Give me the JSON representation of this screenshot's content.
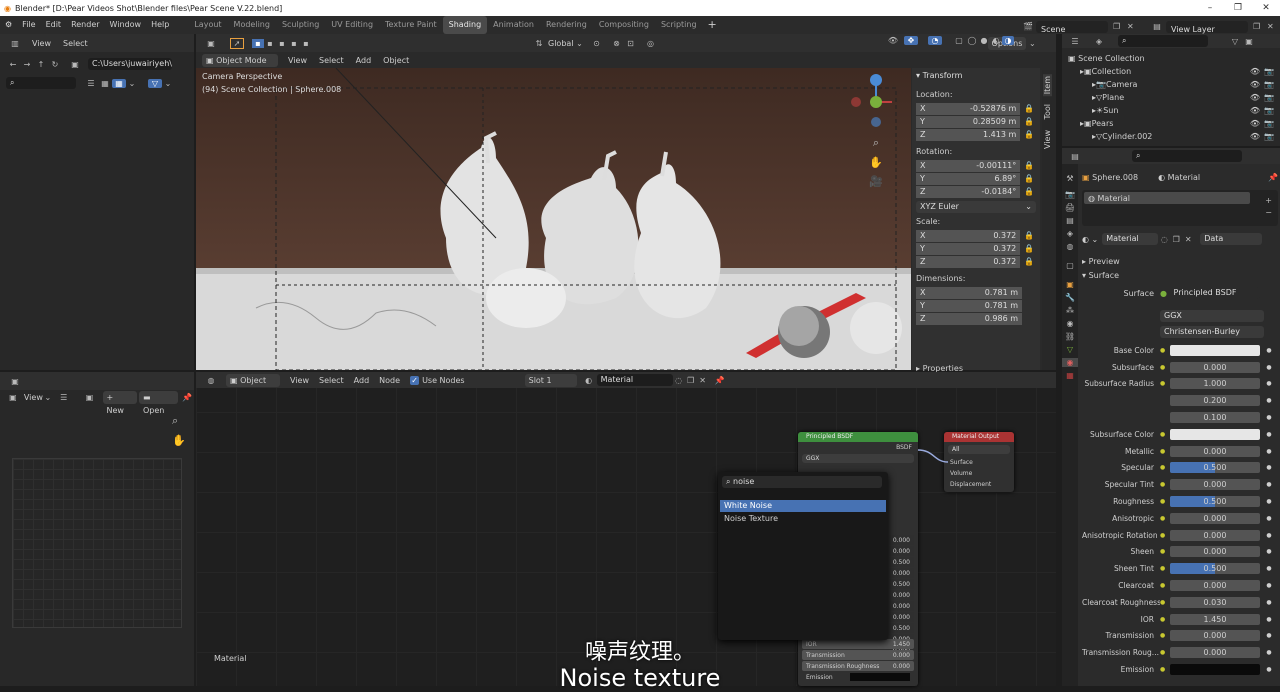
{
  "window": {
    "title": "Blender* [D:\\Pear Videos Shot\\Blender files\\Pear Scene V.22.blend]",
    "minimize": "–",
    "maximize": "❐",
    "close": "✕"
  },
  "menu": {
    "items": [
      "File",
      "Edit",
      "Render",
      "Window",
      "Help"
    ],
    "workspaces": [
      "Layout",
      "Modeling",
      "Sculpting",
      "UV Editing",
      "Texture Paint",
      "Shading",
      "Animation",
      "Rendering",
      "Compositing",
      "Scripting"
    ],
    "active_workspace": "Shading",
    "add_tab": "+",
    "scene": "Scene",
    "view_layer": "View Layer"
  },
  "filebrowser": {
    "view": "View",
    "select": "Select",
    "path": "C:\\Users\\juwairiyeh\\"
  },
  "viewport": {
    "mode": "Object Mode",
    "menus": [
      "View",
      "Select",
      "Add",
      "Object"
    ],
    "orientation": "Global",
    "options": "Options",
    "camera_label": "Camera Perspective",
    "collection_label": "(94) Scene Collection | Sphere.008",
    "transform": {
      "title": "Transform",
      "location_label": "Location:",
      "location": [
        {
          "axis": "X",
          "value": "-0.52876 m"
        },
        {
          "axis": "Y",
          "value": "0.28509 m"
        },
        {
          "axis": "Z",
          "value": "1.413 m"
        }
      ],
      "rotation_label": "Rotation:",
      "rotation": [
        {
          "axis": "X",
          "value": "-0.00111°"
        },
        {
          "axis": "Y",
          "value": "6.89°"
        },
        {
          "axis": "Z",
          "value": "-0.0184°"
        }
      ],
      "rotation_mode": "XYZ Euler",
      "scale_label": "Scale:",
      "scale": [
        {
          "axis": "X",
          "value": "0.372"
        },
        {
          "axis": "Y",
          "value": "0.372"
        },
        {
          "axis": "Z",
          "value": "0.372"
        }
      ],
      "dimensions_label": "Dimensions:",
      "dimensions": [
        {
          "axis": "X",
          "value": "0.781 m"
        },
        {
          "axis": "Y",
          "value": "0.781 m"
        },
        {
          "axis": "Z",
          "value": "0.986 m"
        }
      ],
      "properties": "Properties"
    },
    "side_tabs": [
      "Item",
      "Tool",
      "View"
    ]
  },
  "image_editor": {
    "view": "View",
    "new": "New",
    "open": "Open"
  },
  "node_editor": {
    "object": "Object",
    "menus": [
      "View",
      "Select",
      "Add",
      "Node"
    ],
    "use_nodes": "Use Nodes",
    "slot": "Slot 1",
    "material": "Material",
    "footer_label": "Material",
    "bsdf_node": {
      "title": "Principled BSDF",
      "output": "BSDF",
      "dist": "GGX",
      "ior_label": "IOR",
      "ior": "1.450",
      "transmission_label": "Transmission",
      "transmission": "0.000",
      "trans_rough_label": "Transmission Roughness",
      "trans_rough": "0.000",
      "emission_label": "Emission",
      "values": [
        "0.000",
        "0.000",
        "0.500",
        "0.000",
        "0.500",
        "0.000",
        "0.000",
        "0.000",
        "0.500",
        "0.000",
        "0.000"
      ]
    },
    "output_node": {
      "title": "Material Output",
      "target": "All",
      "sockets": [
        "Surface",
        "Volume",
        "Displacement"
      ]
    },
    "search": {
      "query": "noise",
      "results": [
        "White Noise",
        "Noise Texture"
      ]
    }
  },
  "outliner": {
    "root": "Scene Collection",
    "items": [
      {
        "name": "Collection",
        "depth": 1
      },
      {
        "name": "Camera",
        "depth": 2
      },
      {
        "name": "Plane",
        "depth": 2
      },
      {
        "name": "Sun",
        "depth": 2
      },
      {
        "name": "Pears",
        "depth": 1
      },
      {
        "name": "Cylinder.002",
        "depth": 2
      }
    ]
  },
  "properties": {
    "object": "Sphere.008",
    "material_tab": "Material",
    "slot_item": "Material",
    "material_name": "Material",
    "data": "Data",
    "preview": "Preview",
    "surface_section": "Surface",
    "surface_label": "Surface",
    "surface_value": "Principled BSDF",
    "distribution": "GGX",
    "subsurface_method": "Christensen-Burley",
    "rows": [
      {
        "label": "Base Color",
        "value": "",
        "type": "color",
        "color": "#e6e6e6"
      },
      {
        "label": "Subsurface",
        "value": "0.000"
      },
      {
        "label": "Subsurface Radius",
        "value": "1.000"
      },
      {
        "label": "",
        "value": "0.200"
      },
      {
        "label": "",
        "value": "0.100"
      },
      {
        "label": "Subsurface Color",
        "value": "",
        "type": "color",
        "color": "#e6e6e6"
      },
      {
        "label": "Metallic",
        "value": "0.000"
      },
      {
        "label": "Specular",
        "value": "0.500",
        "fill": 0.5
      },
      {
        "label": "Specular Tint",
        "value": "0.000"
      },
      {
        "label": "Roughness",
        "value": "0.500",
        "fill": 0.5
      },
      {
        "label": "Anisotropic",
        "value": "0.000"
      },
      {
        "label": "Anisotropic Rotation",
        "value": "0.000"
      },
      {
        "label": "Sheen",
        "value": "0.000"
      },
      {
        "label": "Sheen Tint",
        "value": "0.500",
        "fill": 0.5
      },
      {
        "label": "Clearcoat",
        "value": "0.000"
      },
      {
        "label": "Clearcoat Roughness",
        "value": "0.030"
      },
      {
        "label": "IOR",
        "value": "1.450"
      },
      {
        "label": "Transmission",
        "value": "0.000"
      },
      {
        "label": "Transmission Roug...",
        "value": "0.000"
      },
      {
        "label": "Emission",
        "value": "",
        "type": "color",
        "color": "#0a0a0a"
      }
    ]
  },
  "subtitles": {
    "chinese": "噪声纹理。",
    "english": "Noise texture"
  }
}
